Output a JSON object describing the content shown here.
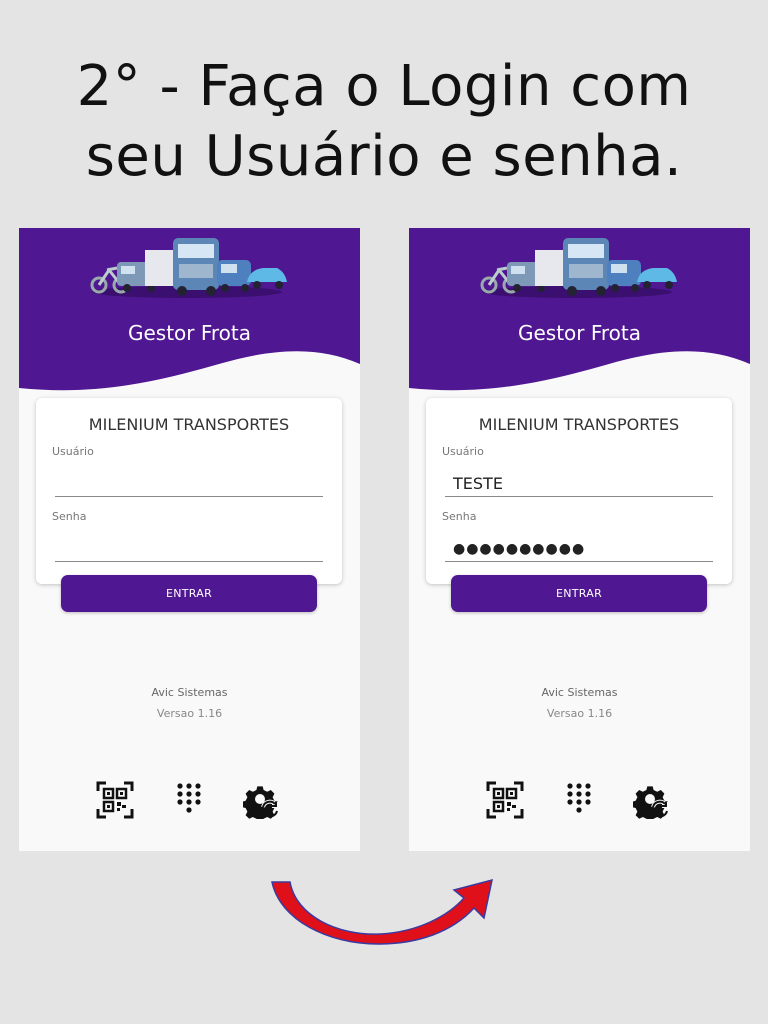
{
  "headline": {
    "line1": "2° - Faça o Login com",
    "line2": "seu Usuário e senha."
  },
  "colors": {
    "brand_purple": "#4f1791",
    "background": "#e4e4e4",
    "screen_bg": "#f9f9f9",
    "arrow_red": "#e0101a",
    "arrow_outline": "#3a3aa0"
  },
  "screens": [
    {
      "app_title": "Gestor Frota",
      "company": "MILENIUM TRANSPORTES",
      "user_label": "Usuário",
      "user_value": "",
      "password_label": "Senha",
      "password_value": "",
      "enter_label": "ENTRAR",
      "footer_company": "Avic Sistemas",
      "version": "Versao 1.16",
      "icons": [
        "qr-code-icon",
        "dialpad-icon",
        "settings-sync-icon"
      ]
    },
    {
      "app_title": "Gestor Frota",
      "company": "MILENIUM TRANSPORTES",
      "user_label": "Usuário",
      "user_value": "TESTE",
      "password_label": "Senha",
      "password_value": "●●●●●●●●●●",
      "enter_label": "ENTRAR",
      "footer_company": "Avic Sistemas",
      "version": "Versao 1.16",
      "icons": [
        "qr-code-icon",
        "dialpad-icon",
        "settings-sync-icon"
      ]
    }
  ]
}
